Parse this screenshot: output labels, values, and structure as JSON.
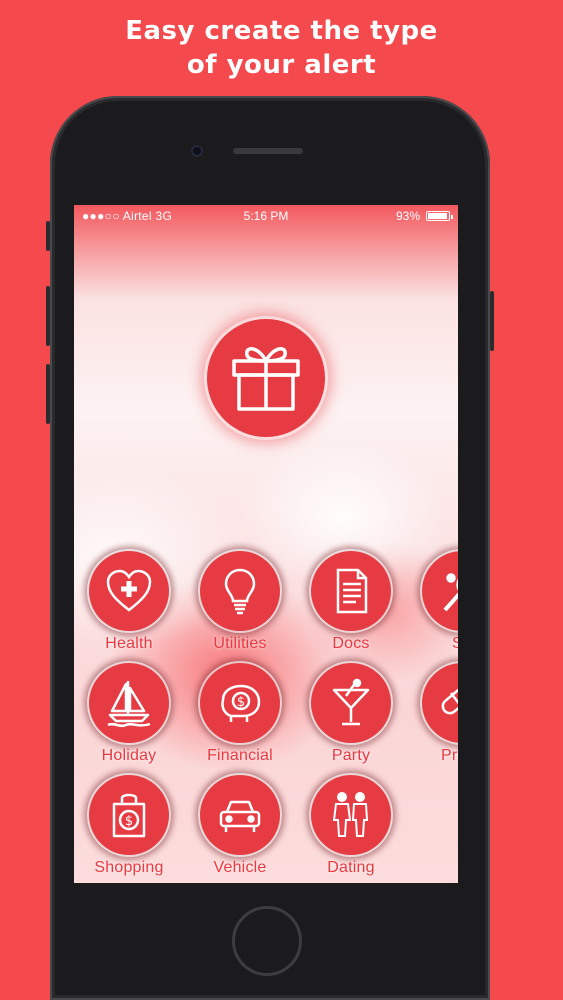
{
  "headline": {
    "line1": "Easy create the type",
    "line2": "of your alert"
  },
  "status_bar": {
    "carrier": "●●●○○ Airtel  3G",
    "time": "5:16 PM",
    "battery": "93%",
    "battery_level": 0.93
  },
  "main_button": {
    "icon": "gift-icon"
  },
  "categories": [
    {
      "label": "Health",
      "icon": "heart-plus-icon"
    },
    {
      "label": "Utilities",
      "icon": "lightbulb-icon"
    },
    {
      "label": "Docs",
      "icon": "document-icon"
    },
    {
      "label": "Sp",
      "icon": "racket-icon"
    },
    {
      "label": "Holiday",
      "icon": "sailboat-icon"
    },
    {
      "label": "Financial",
      "icon": "piggy-bank-icon"
    },
    {
      "label": "Party",
      "icon": "cocktail-icon"
    },
    {
      "label": "Presc",
      "icon": "pill-icon"
    },
    {
      "label": "Shopping",
      "icon": "shopping-bag-icon"
    },
    {
      "label": "Vehicle",
      "icon": "car-icon"
    },
    {
      "label": "Dating",
      "icon": "couple-icon"
    }
  ],
  "colors": {
    "background": "#f44a4e",
    "accent": "#e63b43",
    "text": "#ffffff"
  }
}
